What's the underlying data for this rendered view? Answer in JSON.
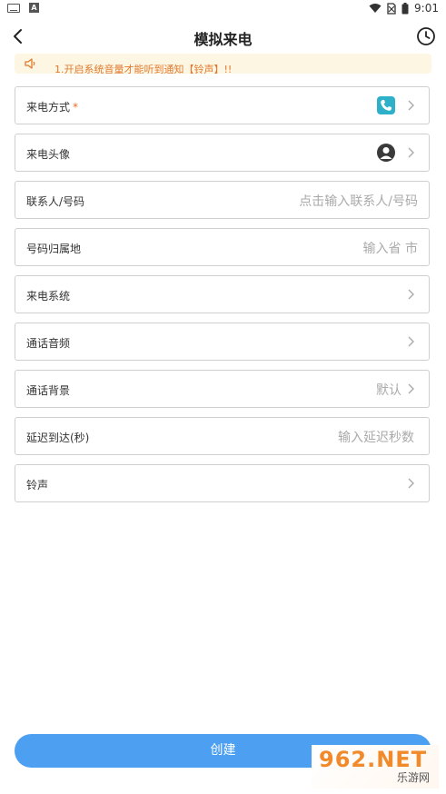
{
  "status_bar": {
    "time": "9:01",
    "a_icon": "A"
  },
  "header": {
    "title": "模拟来电"
  },
  "notice": {
    "text": "1.开启系统音量才能听到通知【铃声】!!"
  },
  "rows": [
    {
      "label": "来电方式",
      "required_mark": "*",
      "icon": "phone-icon"
    },
    {
      "label": "来电头像",
      "icon": "avatar-icon"
    },
    {
      "label": "联系人/号码",
      "placeholder": "点击输入联系人/号码"
    },
    {
      "label": "号码归属地",
      "placeholder": "输入省 市"
    },
    {
      "label": "来电系统"
    },
    {
      "label": "通话音频"
    },
    {
      "label": "通话背景",
      "value": "默认"
    },
    {
      "label": "延迟到达(秒)",
      "placeholder": "输入延迟秒数"
    },
    {
      "label": "铃声"
    }
  ],
  "actions": {
    "create": "创建"
  },
  "watermark": {
    "brand": "962.NET",
    "sub": "乐游网"
  },
  "colors": {
    "accent": "#4d9ff2",
    "notice_bg": "#fdf6e3",
    "notice_text": "#e07a2f",
    "phone_icon": "#2fb0c9"
  }
}
